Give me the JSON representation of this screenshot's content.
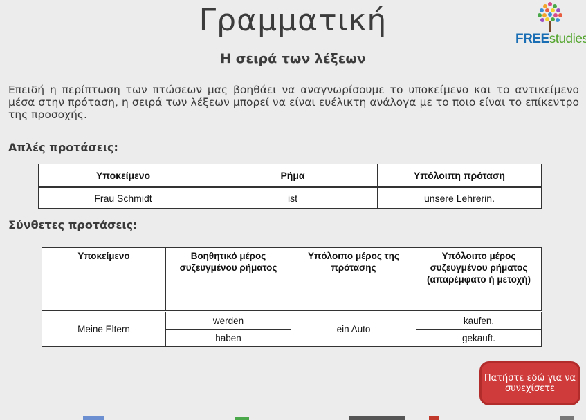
{
  "header": {
    "title": "Γραμματική",
    "subtitle": "Η σειρά των λέξεων",
    "logo": {
      "brand": "FREE",
      "brand_suffix": "studies",
      "colors": {
        "free": "#1a6fb4",
        "studies": "#55a630"
      }
    }
  },
  "intro_text": "Επειδή η περίπτωση των πτώσεων μας βοηθάει να αναγνωρίσουμε το υποκείμενο και το αντικείμενο μέσα στην πρόταση, η σειρά των λέξεων μπορεί να είναι ευέλικτη ανάλογα με το ποιο είναι το επίκεντρο της προσοχής.",
  "simple_section": {
    "label": "Απλές προτάσεις:",
    "headers": [
      "Υποκείμενο",
      "Ρήμα",
      "Υπόλοιπη πρόταση"
    ],
    "row": [
      "Frau Schmidt",
      "ist",
      "unsere Lehrerin."
    ]
  },
  "complex_section": {
    "label": "Σύνθετες προτάσεις:",
    "headers": [
      "Υποκείμενο",
      "Βοηθητικό μέρος συζευγμένου ρήματος",
      "Υπόλοιπο μέρος της πρότασης",
      "Υπόλοιπο μέρος συζευγμένου ρήματος (απαρέμφατο ή μετοχή)"
    ],
    "subject": "Meine Eltern",
    "aux": [
      "werden",
      "haben"
    ],
    "rest": "ein Auto",
    "verb_end": [
      "kaufen.",
      "gekauft."
    ]
  },
  "continue_button": {
    "label": "Πατήστε εδώ για να συνεχίσετε",
    "color": "#cf3b3b"
  }
}
